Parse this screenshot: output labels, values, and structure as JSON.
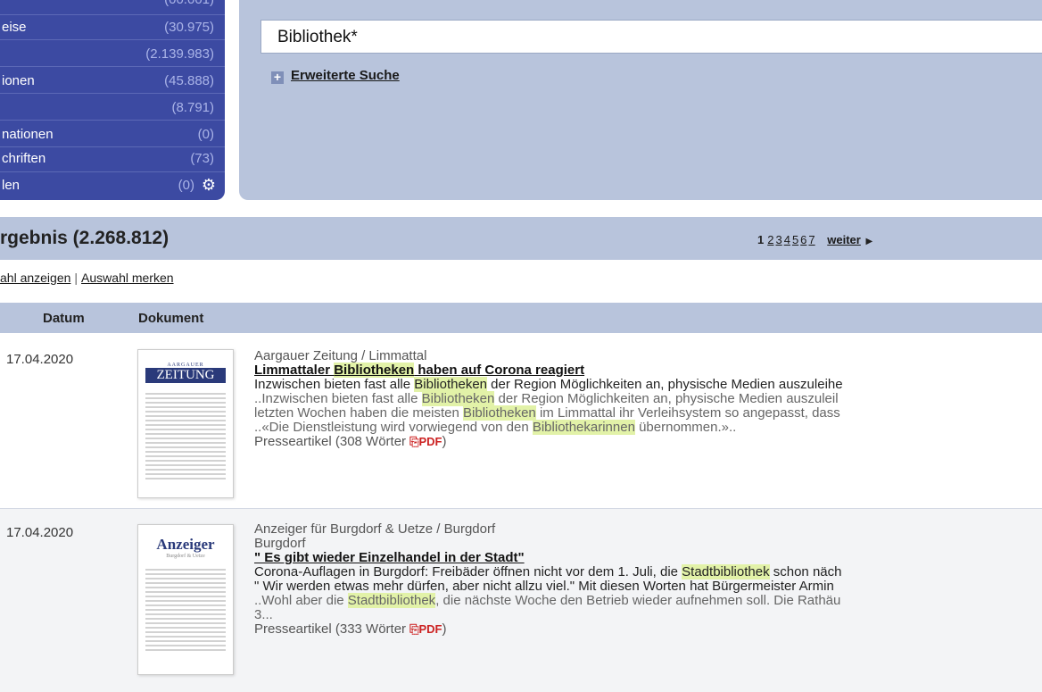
{
  "sidebar": {
    "rows": [
      {
        "label": "",
        "count": "(00.001)"
      },
      {
        "label": "eise",
        "count": "(30.975)"
      },
      {
        "label": "",
        "count": "(2.139.983)"
      },
      {
        "label": "ionen",
        "count": "(45.888)"
      },
      {
        "label": "",
        "count": "(8.791)"
      },
      {
        "label": "nationen",
        "count": "(0)"
      },
      {
        "label": "chriften",
        "count": "(73)"
      },
      {
        "label": "len",
        "count": "(0)"
      }
    ],
    "settings_icon": "gear-icon"
  },
  "search": {
    "query": "Bibliothek*",
    "advanced_label": "Erweiterte Suche",
    "advanced_icon": "plus-icon"
  },
  "results": {
    "title": "rgebnis (2.268.812)",
    "pager": {
      "current": "1",
      "pages": [
        "2",
        "3",
        "4",
        "5",
        "6",
        "7"
      ],
      "next_label": "weiter",
      "next_icon": "triangle-right-icon"
    },
    "actions": {
      "show_selection": "ahl anzeigen",
      "separator": "|",
      "remember_selection": "Auswahl merken"
    },
    "columns": {
      "date": "Datum",
      "document": "Dokument"
    }
  },
  "rows": [
    {
      "date": "17.04.2020",
      "thumb_logo_top": "AARGAUER",
      "thumb_logo": "ZEITUNG",
      "source": "Aargauer Zeitung / Limmattal",
      "title_parts": [
        "Limmattaler ",
        "Bibliotheken",
        " haben auf Corona reagiert"
      ],
      "lead_parts": [
        "Inzwischen bieten fast alle ",
        "Bibliotheken",
        " der Region Möglichkeiten an, physische Medien auszuleihe"
      ],
      "snip1_parts": [
        "..Inzwischen bieten fast alle ",
        "Bibliotheken",
        " der Region Möglichkeiten an, physische Medien auszuleil"
      ],
      "snip2_parts": [
        "letzten Wochen haben die meisten ",
        "Bibliotheken",
        " im Limmattal ihr Verleihsystem so angepasst, dass"
      ],
      "snip3_parts": [
        "..«Die Dienstleistung wird vorwiegend von den ",
        "Bibliothekarinnen",
        " übernommen.».."
      ],
      "meta": "Presseartikel (308 Wörter",
      "meta_close": ")",
      "pdf_icon": "pdf-icon"
    },
    {
      "date": "17.04.2020",
      "thumb_logo": "Anzeiger",
      "thumb_logo_sub": "Burgdorf & Uetze",
      "source": "Anzeiger für Burgdorf & Uetze / Burgdorf",
      "subsource": "Burgdorf",
      "title": "\" Es gibt wieder Einzelhandel in der Stadt\"",
      "lead_parts": [
        "Corona-Auflagen in Burgdorf: Freibäder öffnen nicht vor dem 1. Juli, die ",
        "Stadtbibliothek",
        " schon näch"
      ],
      "lead2": "\" Wir werden etwas mehr dürfen, aber nicht allzu viel.\" Mit diesen Worten hat Bürgermeister Armin",
      "snip_parts": [
        "..Wohl aber die ",
        "Stadtbibliothek",
        ", die nächste Woche den Betrieb wieder aufnehmen soll. Die Rathäu"
      ],
      "snip_tail": "3...",
      "meta": "Presseartikel (333 Wörter",
      "meta_close": ")",
      "pdf_icon": "pdf-icon"
    }
  ],
  "colors": {
    "sidebar_bg": "#3c4aa2",
    "panel_bg": "#b8c4dc",
    "highlight": "#e2f2a8",
    "pdf_red": "#cc2222"
  }
}
